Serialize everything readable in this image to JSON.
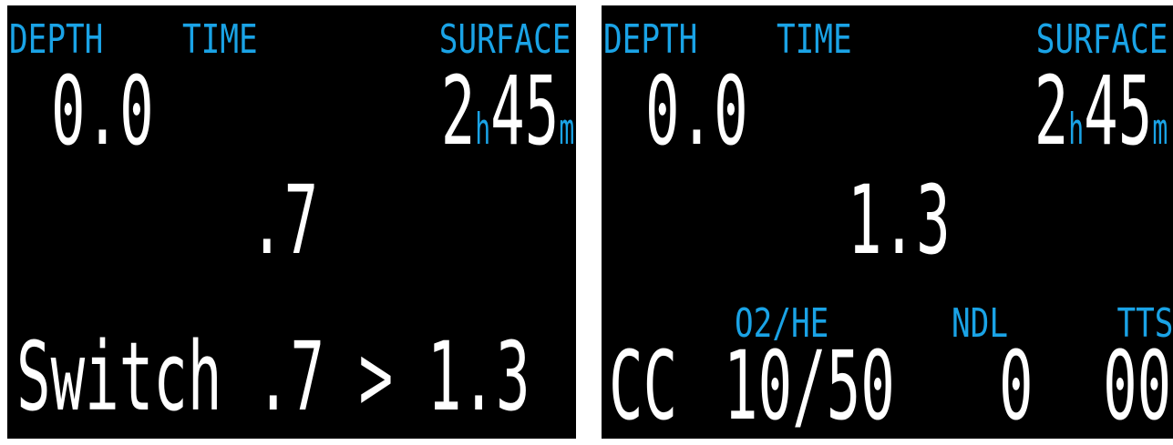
{
  "colors": {
    "label": "#1aa3e6",
    "value": "#ffffff",
    "background": "#000000"
  },
  "left_screen": {
    "depth_label": "DEPTH",
    "time_label": "TIME",
    "surface_label": "SURFACE",
    "depth_value": "0.0",
    "surface_hours": "2",
    "hours_unit": "h",
    "surface_minutes": "45",
    "minutes_unit": "m",
    "ppo2_value": ".7",
    "switch_message": "Switch .7 > 1.3"
  },
  "right_screen": {
    "depth_label": "DEPTH",
    "time_label": "TIME",
    "surface_label": "SURFACE",
    "depth_value": "0.0",
    "surface_hours": "2",
    "hours_unit": "h",
    "surface_minutes": "45",
    "minutes_unit": "m",
    "ppo2_value": "1.3",
    "gas_label": "O2/HE",
    "ndl_label": "NDL",
    "tts_label": "TTS",
    "mode_value": "CC",
    "gas_value": "10/50",
    "ndl_value": "0",
    "tts_value": "00"
  }
}
